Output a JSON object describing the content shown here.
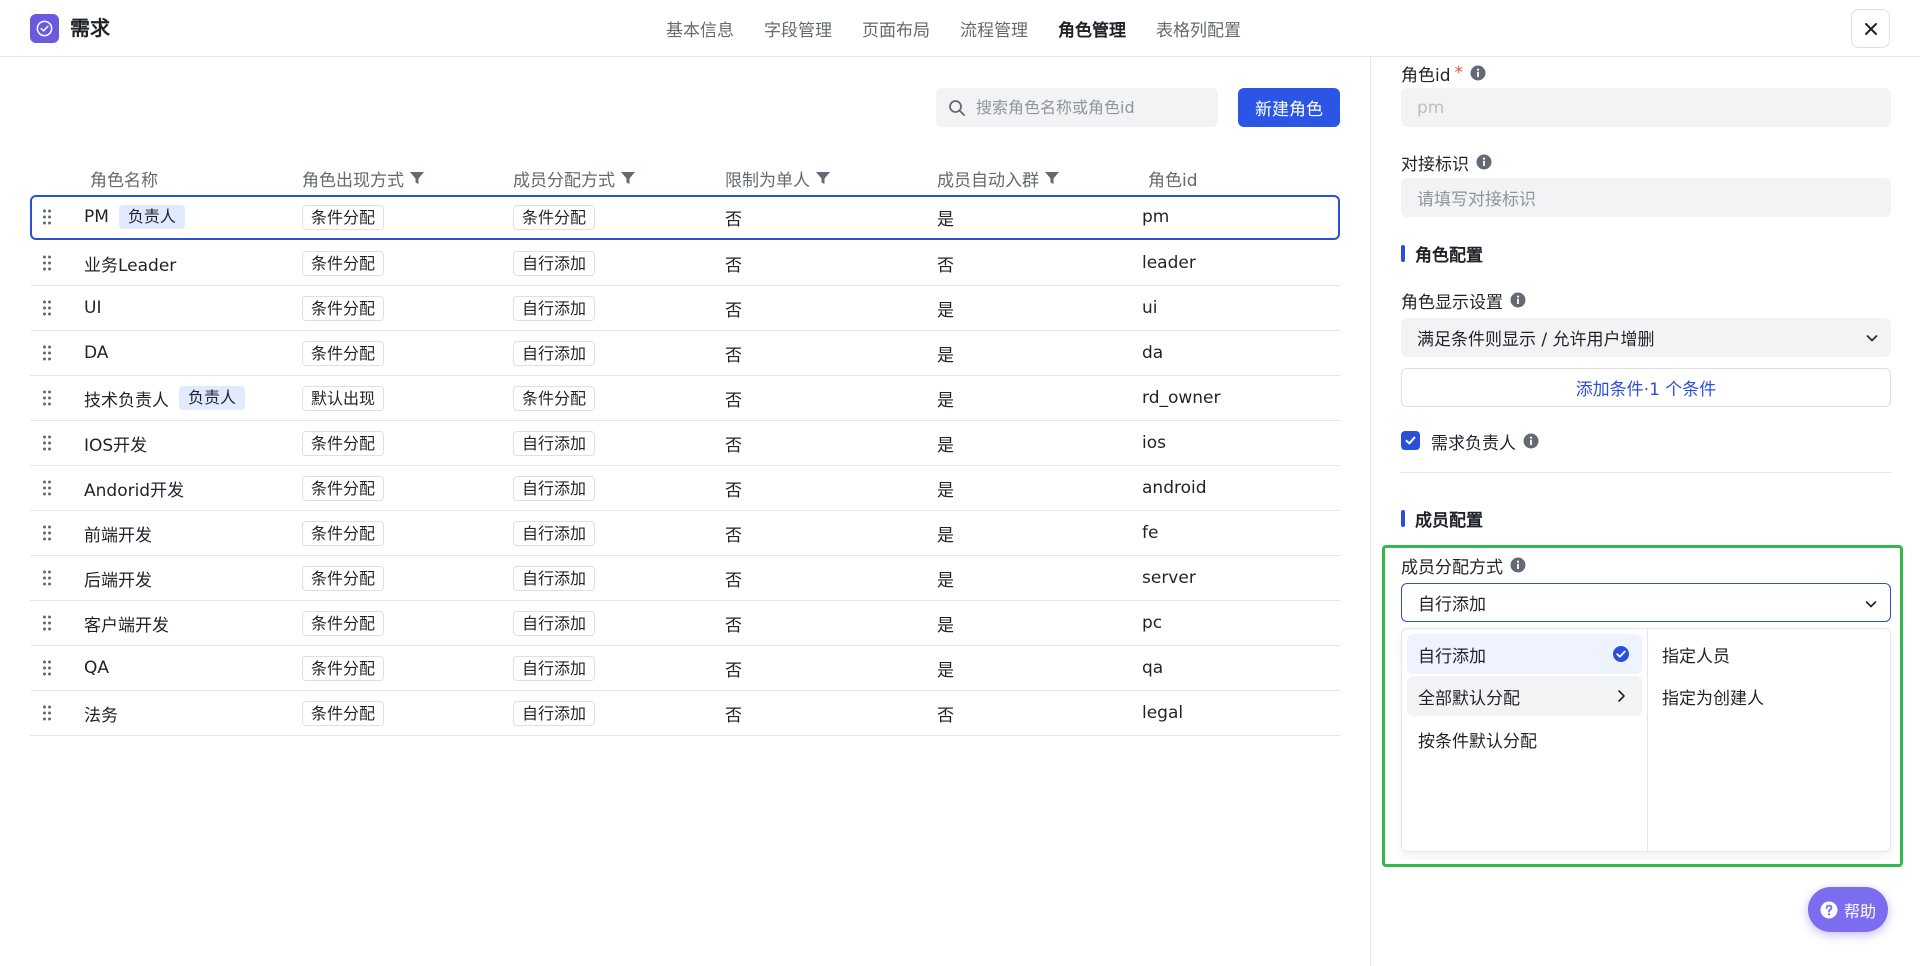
{
  "header": {
    "title": "需求",
    "tabs": [
      {
        "label": "基本信息",
        "active": false
      },
      {
        "label": "字段管理",
        "active": false
      },
      {
        "label": "页面布局",
        "active": false
      },
      {
        "label": "流程管理",
        "active": false
      },
      {
        "label": "角色管理",
        "active": true
      },
      {
        "label": "表格列配置",
        "active": false
      }
    ]
  },
  "toolbar": {
    "search_placeholder": "搜索角色名称或角色id",
    "new_role_label": "新建角色"
  },
  "table": {
    "columns": [
      "角色名称",
      "角色出现方式",
      "成员分配方式",
      "限制为单人",
      "成员自动入群",
      "角色id"
    ],
    "filterable": [
      false,
      true,
      true,
      true,
      true,
      false
    ],
    "rows": [
      {
        "name": "PM",
        "owner_tag": "负责人",
        "appear": "条件分配",
        "assign": "条件分配",
        "single": "否",
        "autojoin": "是",
        "id": "pm",
        "selected": true
      },
      {
        "name": "业务Leader",
        "owner_tag": "",
        "appear": "条件分配",
        "assign": "自行添加",
        "single": "否",
        "autojoin": "否",
        "id": "leader"
      },
      {
        "name": "UI",
        "owner_tag": "",
        "appear": "条件分配",
        "assign": "自行添加",
        "single": "否",
        "autojoin": "是",
        "id": "ui"
      },
      {
        "name": "DA",
        "owner_tag": "",
        "appear": "条件分配",
        "assign": "自行添加",
        "single": "否",
        "autojoin": "是",
        "id": "da"
      },
      {
        "name": "技术负责人",
        "owner_tag": "负责人",
        "appear": "默认出现",
        "assign": "条件分配",
        "single": "否",
        "autojoin": "是",
        "id": "rd_owner"
      },
      {
        "name": "IOS开发",
        "owner_tag": "",
        "appear": "条件分配",
        "assign": "自行添加",
        "single": "否",
        "autojoin": "是",
        "id": "ios"
      },
      {
        "name": "Andorid开发",
        "owner_tag": "",
        "appear": "条件分配",
        "assign": "自行添加",
        "single": "否",
        "autojoin": "是",
        "id": "android"
      },
      {
        "name": "前端开发",
        "owner_tag": "",
        "appear": "条件分配",
        "assign": "自行添加",
        "single": "否",
        "autojoin": "是",
        "id": "fe"
      },
      {
        "name": "后端开发",
        "owner_tag": "",
        "appear": "条件分配",
        "assign": "自行添加",
        "single": "否",
        "autojoin": "是",
        "id": "server"
      },
      {
        "name": "客户端开发",
        "owner_tag": "",
        "appear": "条件分配",
        "assign": "自行添加",
        "single": "否",
        "autojoin": "是",
        "id": "pc"
      },
      {
        "name": "QA",
        "owner_tag": "",
        "appear": "条件分配",
        "assign": "自行添加",
        "single": "否",
        "autojoin": "是",
        "id": "qa"
      },
      {
        "name": "法务",
        "owner_tag": "",
        "appear": "条件分配",
        "assign": "自行添加",
        "single": "否",
        "autojoin": "否",
        "id": "legal"
      }
    ]
  },
  "panel": {
    "role_id_label": "角色id",
    "role_id_required": "*",
    "role_id_value": "pm",
    "connect_label": "对接标识",
    "connect_placeholder": "请填写对接标识",
    "role_config_title": "角色配置",
    "display_label": "角色显示设置",
    "display_value": "满足条件则显示 / 允许用户增删",
    "add_condition_label": "添加条件·1 个条件",
    "owner_checkbox_label": "需求负责人",
    "owner_checked": true,
    "member_config_title": "成员配置",
    "assign_label": "成员分配方式",
    "assign_value": "自行添加",
    "dropdown_options": [
      "自行添加",
      "全部默认分配",
      "按条件默认分配"
    ],
    "dropdown_suboptions": [
      "指定人员",
      "指定为创建人"
    ]
  },
  "help": {
    "label": "帮助"
  },
  "colors": {
    "accent": "#2a4fdb",
    "brand": "#6a5ae0",
    "highlight": "#34b84d"
  }
}
